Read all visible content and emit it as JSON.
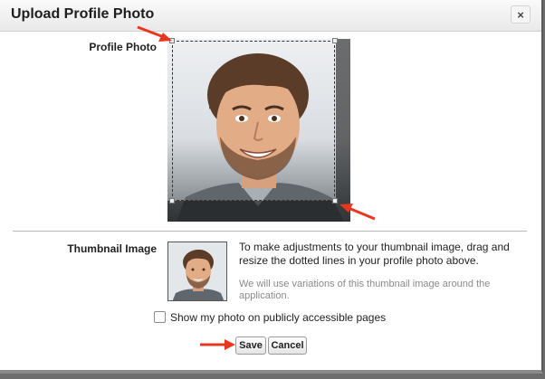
{
  "dialog": {
    "title": "Upload Profile Photo",
    "close_label": "×"
  },
  "photo_section": {
    "label": "Profile Photo"
  },
  "thumbnail_section": {
    "label": "Thumbnail Image",
    "instructions": "To make adjustments to your thumbnail image, drag and resize the dotted lines in your profile photo above.",
    "note": "We will use variations of this thumbnail image around the application."
  },
  "public_photo": {
    "label": "Show my photo on publicly accessible pages",
    "checked": false
  },
  "buttons": {
    "save": "Save",
    "cancel": "Cancel"
  },
  "colors": {
    "annotation_arrow": "#e8371f"
  }
}
